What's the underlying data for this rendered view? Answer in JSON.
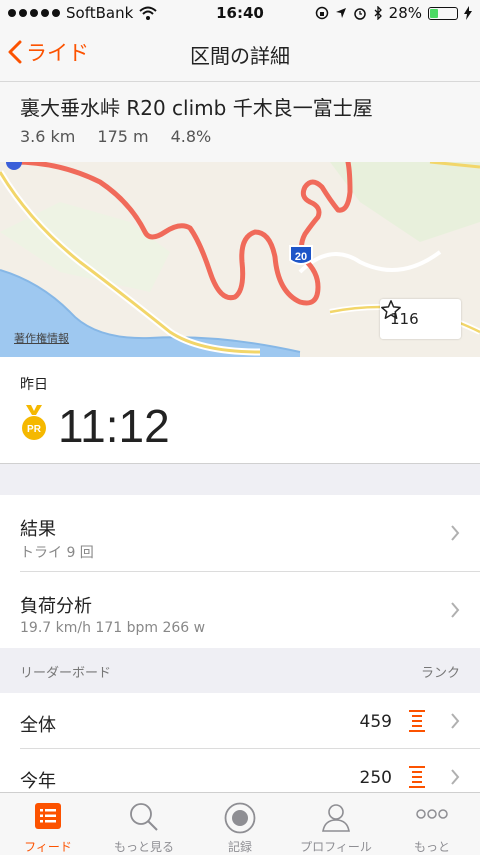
{
  "status": {
    "carrier": "SoftBank",
    "time": "16:40",
    "battery": "28%"
  },
  "nav": {
    "back_label": "ライド",
    "title": "区間の詳細"
  },
  "segment": {
    "name": "裏大垂水峠 R20 climb 千木良一富士屋",
    "distance": "3.6 km",
    "elevation": "175 m",
    "grade": "4.8%"
  },
  "map": {
    "copyright": "著作権情報",
    "route_shield": "20",
    "star_count": "116"
  },
  "effort": {
    "date_label": "昨日",
    "medal_text": "PR",
    "time": "11:12"
  },
  "rows": {
    "results": {
      "title": "結果",
      "sub": "トライ 9 回"
    },
    "analysis": {
      "title": "負荷分析",
      "sub": "19.7 km/h 171 bpm 266 w"
    }
  },
  "leaderboard": {
    "header_left": "リーダーボード",
    "header_right": "ランク",
    "entries": [
      {
        "name": "全体",
        "rank": "459"
      },
      {
        "name": "今年",
        "rank": "250"
      }
    ]
  },
  "tabs": [
    {
      "label": "フィード",
      "icon": "feed-icon",
      "active": true
    },
    {
      "label": "もっと見る",
      "icon": "search-icon",
      "active": false
    },
    {
      "label": "記録",
      "icon": "record-icon",
      "active": false
    },
    {
      "label": "プロフィール",
      "icon": "profile-icon",
      "active": false
    },
    {
      "label": "もっと",
      "icon": "more-icon",
      "active": false
    }
  ],
  "colors": {
    "accent": "#fc5200",
    "route": "#f06a5a",
    "medal": "#f5b800"
  }
}
